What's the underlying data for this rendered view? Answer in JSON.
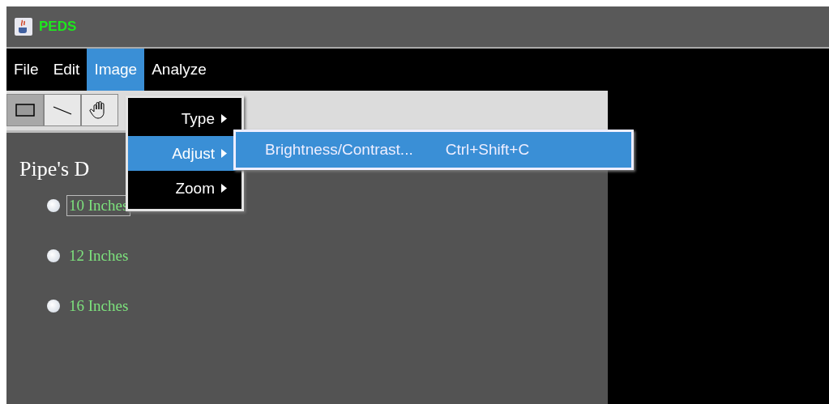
{
  "window": {
    "title": "PEDS"
  },
  "menu_bar": [
    {
      "label": "File",
      "selected": false
    },
    {
      "label": "Edit",
      "selected": false
    },
    {
      "label": "Image",
      "selected": true
    },
    {
      "label": "Analyze",
      "selected": false
    }
  ],
  "tools": [
    {
      "kind": "rectangle",
      "selected": true
    },
    {
      "kind": "line",
      "selected": false
    },
    {
      "kind": "hand",
      "selected": false
    }
  ],
  "image_menu": [
    {
      "label": "Type",
      "selected": false
    },
    {
      "label": "Adjust",
      "selected": true
    },
    {
      "label": "Zoom",
      "selected": false
    }
  ],
  "adjust_submenu": [
    {
      "label": "Brightness/Contrast...",
      "shortcut": "Ctrl+Shift+C",
      "selected": true
    }
  ],
  "panel": {
    "heading": "Pipe's D",
    "options": [
      {
        "label": "10 Inches",
        "selected": false,
        "focused": true
      },
      {
        "label": "12 Inches",
        "selected": false,
        "focused": false
      },
      {
        "label": "16 Inches",
        "selected": false,
        "focused": false
      }
    ]
  }
}
